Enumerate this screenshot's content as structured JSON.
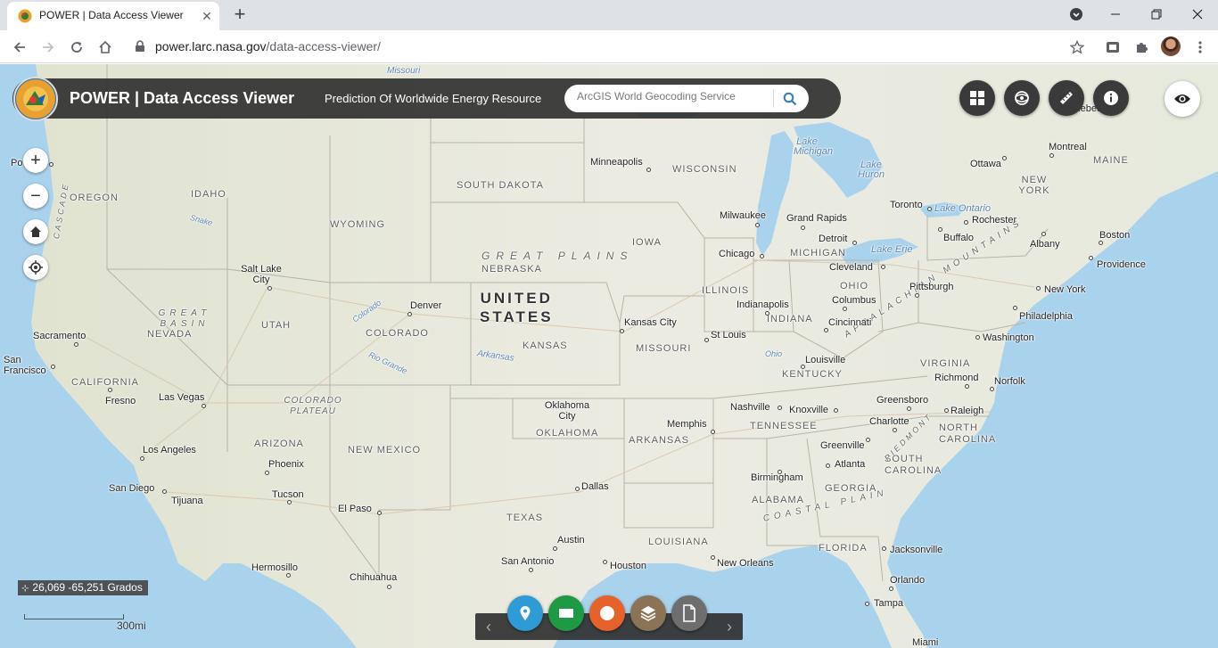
{
  "browser": {
    "tab_title": "POWER | Data Access Viewer",
    "url_host": "power.larc.nasa.gov",
    "url_path": "/data-access-viewer/"
  },
  "app": {
    "title": "POWER | Data Access Viewer",
    "subtitle": "Prediction Of Worldwide Energy Resource",
    "search_placeholder": "ArcGIS World Geocoding Service"
  },
  "map": {
    "coordinates": "26,069 -65,251 Grados",
    "scale_label": "300mi",
    "country_label": "UNITED\nSTATES",
    "states": [
      "OREGON",
      "IDAHO",
      "WYOMING",
      "SOUTH DAKOTA",
      "NEBRASKA",
      "IOWA",
      "WISCONSIN",
      "MICHIGAN",
      "ILLINOIS",
      "INDIANA",
      "OHIO",
      "NEVADA",
      "UTAH",
      "COLORADO",
      "KANSAS",
      "MISSOURI",
      "KENTUCKY",
      "VIRGINIA",
      "TENNESSEE",
      "NORTH CAROLINA",
      "SOUTH CAROLINA",
      "GEORGIA",
      "ALABAMA",
      "ARKANSAS",
      "OKLAHOMA",
      "TEXAS",
      "LOUISIANA",
      "NEW MEXICO",
      "ARIZONA",
      "CALIFORNIA",
      "FLORIDA",
      "MAINE",
      "NEW YORK"
    ],
    "cities": [
      "Minneapolis",
      "Milwaukee",
      "Grand Rapids",
      "Detroit",
      "Chicago",
      "Cleveland",
      "Toronto",
      "Rochester",
      "Buffalo",
      "Albany",
      "Boston",
      "Providence",
      "Montreal",
      "Ottawa",
      "Quebec",
      "Pittsburgh",
      "New York",
      "Philadelphia",
      "Washington",
      "Richmond",
      "Norfolk",
      "Greensboro",
      "Raleigh",
      "Charlotte",
      "Greenville",
      "Atlanta",
      "Knoxville",
      "Nashville",
      "Memphis",
      "Louisville",
      "Indianapolis",
      "Columbus",
      "Cincinnati",
      "St Louis",
      "Kansas City",
      "Denver",
      "Salt Lake City",
      "Sacramento",
      "San Francisco",
      "Fresno",
      "Las Vegas",
      "Los Angeles",
      "San Diego",
      "Tijuana",
      "Phoenix",
      "Tucson",
      "El Paso",
      "Oklahoma City",
      "Dallas",
      "Austin",
      "San Antonio",
      "Houston",
      "New Orleans",
      "Birmingham",
      "Jacksonville",
      "Orlando",
      "Tampa",
      "Miami",
      "Hermosillo",
      "Chihuahua",
      "Po"
    ],
    "regions": [
      "GREAT PLAINS",
      "APPALACHIAN MOUNTAINS",
      "GREAT BASIN",
      "COLORADO PLATEAU",
      "COASTAL PLAIN",
      "PIEDMONT",
      "CASCADE"
    ],
    "waters": [
      "Lake Michigan",
      "Lake Huron",
      "Lake Ontario",
      "Lake Erie",
      "Missouri",
      "Arkansas",
      "Rio Grande",
      "Colorado",
      "Ohio",
      "Snake"
    ]
  },
  "toolbar_icons": [
    "grid-icon",
    "exploration-icon",
    "ruler-icon",
    "info-icon",
    "eye-icon"
  ],
  "bottom_icons": [
    "marker-icon",
    "rectangle-icon",
    "circle-icon",
    "layers-icon",
    "document-icon"
  ],
  "colors": {
    "blue": "#2e9ad6",
    "green": "#1e9a45",
    "orange": "#e6622a",
    "brown": "#8b7355",
    "gray": "#6e6e6e"
  }
}
